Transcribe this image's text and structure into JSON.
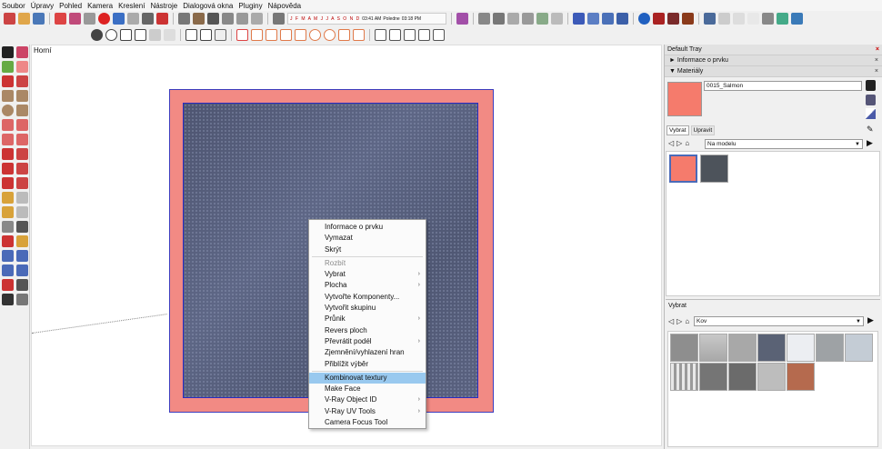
{
  "menu": [
    "Soubor",
    "Úpravy",
    "Pohled",
    "Kamera",
    "Kreslení",
    "Nástroje",
    "Dialogová okna",
    "Pluginy",
    "Nápověda"
  ],
  "shadows": {
    "months": "J F M A M J J A S O N D",
    "time_start": "03:41 AM",
    "time_noon": "Poledne",
    "time_end": "03:18 PM"
  },
  "viewport": {
    "scene_label": "Horní"
  },
  "context_menu": {
    "items": [
      {
        "label": "Informace o prvku",
        "state": "enabled",
        "submenu": false
      },
      {
        "label": "Vymazat",
        "state": "enabled",
        "submenu": false
      },
      {
        "label": "Skrýt",
        "state": "enabled",
        "submenu": false
      },
      {
        "label": "Rozbít",
        "state": "disabled",
        "submenu": false
      },
      {
        "label": "Vybrat",
        "state": "enabled",
        "submenu": true
      },
      {
        "label": "Plocha",
        "state": "enabled",
        "submenu": true
      },
      {
        "label": "Vytvořte Komponenty...",
        "state": "enabled",
        "submenu": false
      },
      {
        "label": "Vytvořit skupinu",
        "state": "enabled",
        "submenu": false
      },
      {
        "label": "Průnik",
        "state": "enabled",
        "submenu": true
      },
      {
        "label": "Revers ploch",
        "state": "enabled",
        "submenu": false
      },
      {
        "label": "Převrátit podél",
        "state": "enabled",
        "submenu": true
      },
      {
        "label": "Zjemnění/vyhlazení hran",
        "state": "enabled",
        "submenu": false
      },
      {
        "label": "Přiblížit výběr",
        "state": "enabled",
        "submenu": false
      },
      {
        "label": "Kombinovat textury",
        "state": "highlighted",
        "submenu": false
      },
      {
        "label": "Make Face",
        "state": "enabled",
        "submenu": false
      },
      {
        "label": "V-Ray Object ID",
        "state": "enabled",
        "submenu": true
      },
      {
        "label": "V-Ray UV Tools",
        "state": "enabled",
        "submenu": true
      },
      {
        "label": "Camera Focus Tool",
        "state": "enabled",
        "submenu": false
      }
    ],
    "submenu_arrow": "›"
  },
  "tray": {
    "title": "Default Tray",
    "close": "×",
    "panel_entity_info": "Informace o prvku",
    "panel_materials": "Materiály",
    "collapsed_marker": "►",
    "expanded_marker": "▼",
    "material_name": "0015_Salmon",
    "material_color": "#f57b6c",
    "tab_select": "Vybrat",
    "tab_edit": "Upravit",
    "collection": "Na modelu",
    "model_materials": [
      {
        "name": "salmon",
        "color": "#f57b6c"
      },
      {
        "name": "steel",
        "color": "#4d535b"
      }
    ],
    "bottom_title": "Vybrat",
    "bottom_collection": "Kov",
    "metal_thumbs": [
      {
        "name": "metal-rough",
        "color": "#8e8e8e"
      },
      {
        "name": "metal-brushed",
        "color": "#b8b8b8"
      },
      {
        "name": "metal-diamond-plate",
        "color": "#a8a8a8"
      },
      {
        "name": "metal-dark-blue",
        "color": "#5a6275"
      },
      {
        "name": "metal-white",
        "color": "#eceef2"
      },
      {
        "name": "metal-galvanized",
        "color": "#9ea2a5"
      },
      {
        "name": "metal-frosted",
        "color": "#c4ccd5"
      },
      {
        "name": "metal-corrugated",
        "color": "#d4d4d4"
      },
      {
        "name": "metal-stamped",
        "color": "#757575"
      },
      {
        "name": "metal-grey",
        "color": "#6b6b6b"
      },
      {
        "name": "metal-polished",
        "color": "#bdbdbd"
      },
      {
        "name": "metal-rust",
        "color": "#b56a4e"
      }
    ]
  }
}
